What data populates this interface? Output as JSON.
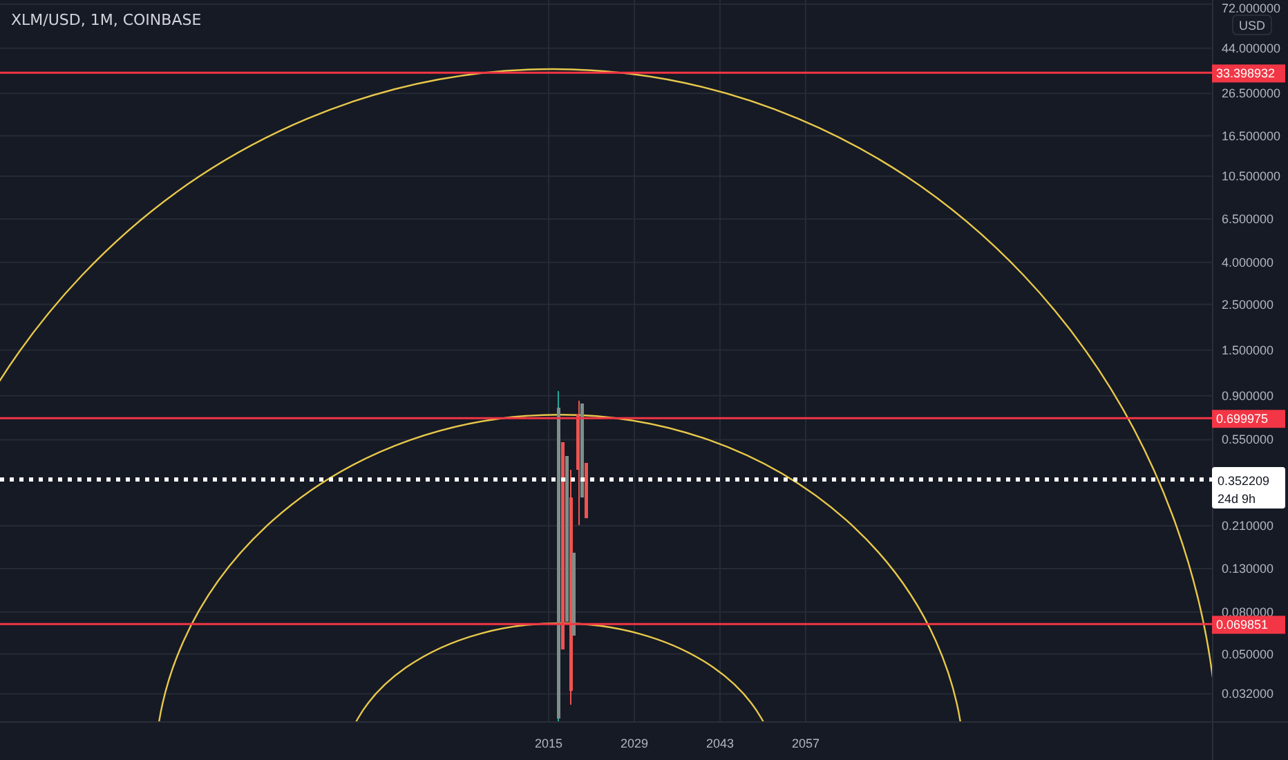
{
  "legend": {
    "title": "XLM/USD, 1M, COINBASE"
  },
  "price_axis": {
    "currency": "USD",
    "ticks": [
      "72.000000",
      "44.000000",
      "26.500000",
      "16.500000",
      "10.500000",
      "6.500000",
      "4.000000",
      "2.500000",
      "1.500000",
      "0.900000",
      "0.550000",
      "0.210000",
      "0.130000",
      "0.080000",
      "0.050000",
      "0.032000"
    ]
  },
  "horizontal_lines": [
    {
      "label": "33.398932",
      "color": "#f23645"
    },
    {
      "label": "0.699975",
      "color": "#f23645"
    },
    {
      "label": "0.069851",
      "color": "#f23645"
    }
  ],
  "current_price": {
    "label": "0.352209",
    "countdown": "24d 9h"
  },
  "time_axis": {
    "ticks": [
      "2015",
      "2029",
      "2043",
      "2057"
    ]
  }
}
